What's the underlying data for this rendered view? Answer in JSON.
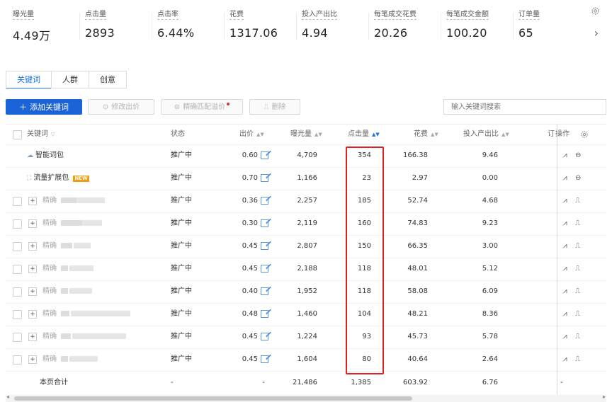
{
  "metrics": [
    {
      "label": "曝光量",
      "value": "4.49万"
    },
    {
      "label": "点击量",
      "value": "2893"
    },
    {
      "label": "点击率",
      "value": "6.44%"
    },
    {
      "label": "花费",
      "value": "1317.06"
    },
    {
      "label": "投入产出比",
      "value": "4.94"
    },
    {
      "label": "每笔成交花费",
      "value": "20.26"
    },
    {
      "label": "每笔成交金额",
      "value": "100.20"
    },
    {
      "label": "订单量",
      "value": "65"
    }
  ],
  "tabs": [
    {
      "label": "关键词",
      "active": true
    },
    {
      "label": "人群",
      "active": false
    },
    {
      "label": "创意",
      "active": false
    }
  ],
  "toolbar": {
    "add_label": "添加关键词",
    "modify_bid_label": "修改出价",
    "precise_premium_label": "精确匹配溢价",
    "delete_label": "删除",
    "search_placeholder": "输入关键词搜索"
  },
  "columns": {
    "keyword": "关键词",
    "status": "状态",
    "bid": "出价",
    "impressions": "曝光量",
    "clicks": "点击量",
    "cost": "花费",
    "roi": "投入产出比",
    "orders": "订",
    "ops": "操作"
  },
  "rows": [
    {
      "keyword": "智能词包",
      "type": "smart",
      "status": "推广中",
      "bid": "0.60",
      "impressions": "4,709",
      "clicks": "354",
      "cost": "166.38",
      "roi": "9.46"
    },
    {
      "keyword": "流量扩展包",
      "type": "expand",
      "badge": "NEW",
      "status": "推广中",
      "bid": "0.70",
      "impressions": "1,166",
      "clicks": "23",
      "cost": "2.97",
      "roi": "0.00"
    },
    {
      "keyword": "精确",
      "type": "normal",
      "status": "推广中",
      "bid": "0.36",
      "impressions": "2,257",
      "clicks": "185",
      "cost": "52.74",
      "roi": "4.68"
    },
    {
      "keyword": "精确",
      "type": "normal",
      "status": "推广中",
      "bid": "0.30",
      "impressions": "2,119",
      "clicks": "160",
      "cost": "74.83",
      "roi": "9.23"
    },
    {
      "keyword": "精确",
      "type": "normal",
      "status": "推广中",
      "bid": "0.45",
      "impressions": "2,807",
      "clicks": "150",
      "cost": "66.35",
      "roi": "3.00"
    },
    {
      "keyword": "精确",
      "type": "normal",
      "status": "推广中",
      "bid": "0.45",
      "impressions": "2,188",
      "clicks": "118",
      "cost": "48.01",
      "roi": "5.12"
    },
    {
      "keyword": "精确",
      "type": "normal",
      "status": "推广中",
      "bid": "0.40",
      "impressions": "1,952",
      "clicks": "118",
      "cost": "58.08",
      "roi": "6.09"
    },
    {
      "keyword": "精确",
      "type": "normal",
      "status": "推广中",
      "bid": "0.48",
      "impressions": "1,460",
      "clicks": "104",
      "cost": "48.21",
      "roi": "8.36"
    },
    {
      "keyword": "精确",
      "type": "normal",
      "status": "推广中",
      "bid": "0.45",
      "impressions": "1,224",
      "clicks": "93",
      "cost": "45.73",
      "roi": "5.78"
    },
    {
      "keyword": "精确",
      "type": "normal",
      "status": "推广中",
      "bid": "0.45",
      "impressions": "1,604",
      "clicks": "80",
      "cost": "40.64",
      "roi": "2.64"
    }
  ],
  "summary": {
    "label": "本页合计",
    "status": "-",
    "bid": "-",
    "impressions": "21,486",
    "clicks": "1,385",
    "cost": "603.92",
    "roi": "6.76",
    "orders": "-"
  },
  "colors": {
    "accent": "#1a63d8",
    "highlight": "#e02020",
    "badge": "#f39c12"
  }
}
